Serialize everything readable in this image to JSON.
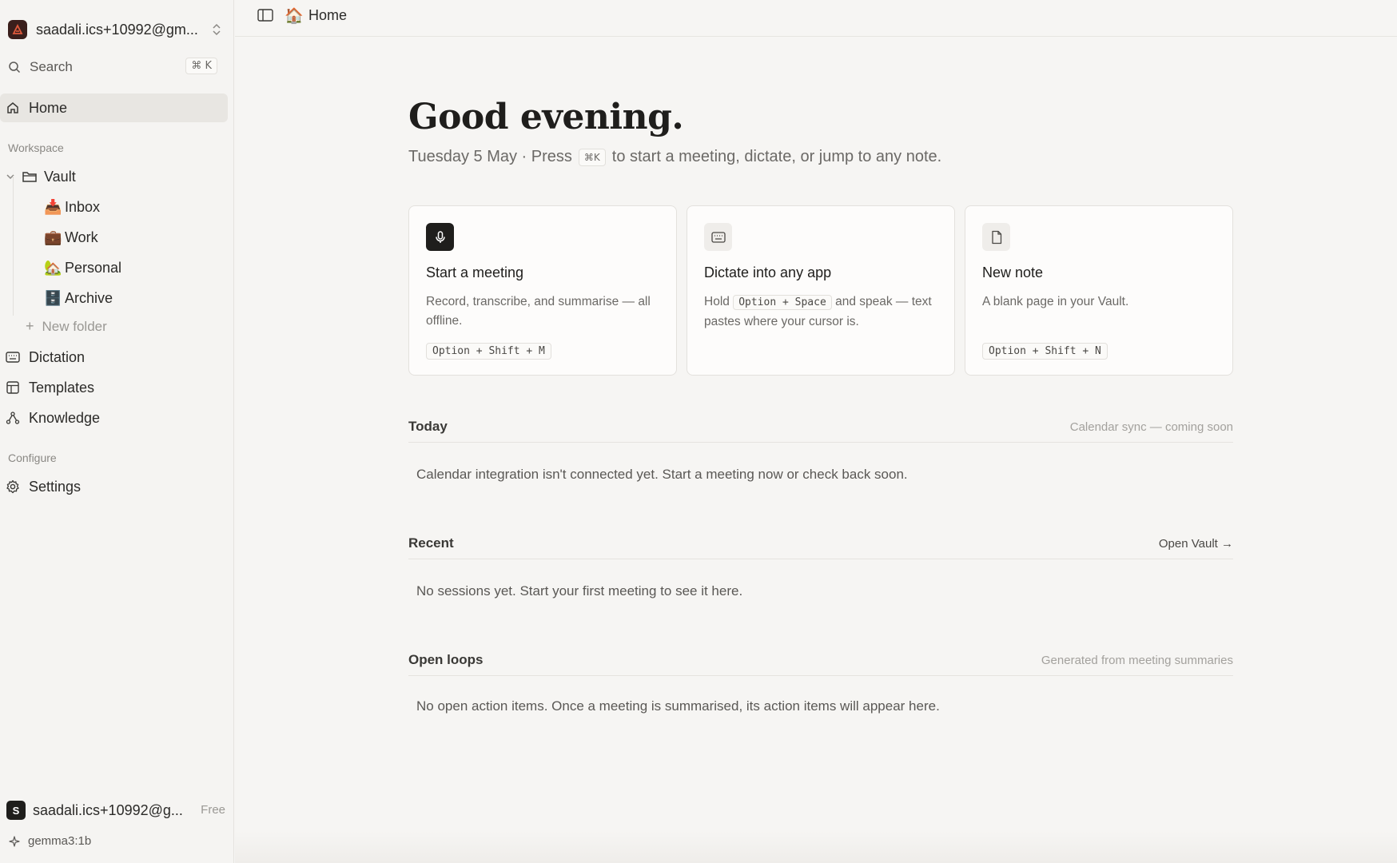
{
  "sidebar": {
    "account": {
      "name": "saadali.ics+10992@gm..."
    },
    "search": {
      "label": "Search",
      "shortcut": "⌘ K"
    },
    "home_label": "Home",
    "workspace_label": "Workspace",
    "vault_label": "Vault",
    "folders": [
      {
        "emoji": "📥",
        "label": "Inbox"
      },
      {
        "emoji": "💼",
        "label": "Work"
      },
      {
        "emoji": "🏡",
        "label": "Personal"
      },
      {
        "emoji": "🗄️",
        "label": "Archive"
      }
    ],
    "new_folder_label": "New folder",
    "dictation_label": "Dictation",
    "templates_label": "Templates",
    "knowledge_label": "Knowledge",
    "configure_label": "Configure",
    "settings_label": "Settings",
    "user": {
      "initial": "S",
      "name": "saadali.ics+10992@g...",
      "plan": "Free"
    },
    "model": "gemma3:1b"
  },
  "topbar": {
    "breadcrumb_emoji": "🏠",
    "breadcrumb": "Home"
  },
  "main": {
    "greeting": "Good evening.",
    "subline": {
      "date_text": "Tuesday 5 May · Press",
      "kbd": "⌘K",
      "rest": "to start a meeting, dictate, or jump to any note."
    },
    "cards": [
      {
        "icon": "microphone-icon",
        "title": "Start a meeting",
        "desc": "Record, transcribe, and summarise — all offline.",
        "shortcut": "Option + Shift + M"
      },
      {
        "icon": "keyboard-icon",
        "title": "Dictate into any app",
        "desc_pre": "Hold",
        "desc_kbd": "Option + Space",
        "desc_post": "and speak — text pastes where your cursor is."
      },
      {
        "icon": "document-icon",
        "title": "New note",
        "desc": "A blank page in your Vault.",
        "shortcut": "Option + Shift + N"
      }
    ],
    "today": {
      "title": "Today",
      "aside": "Calendar sync — coming soon",
      "message": "Calendar integration isn't connected yet. Start a meeting now or check back soon."
    },
    "recent": {
      "title": "Recent",
      "aside": "Open Vault →",
      "message": "No sessions yet. Start your first meeting to see it here."
    },
    "open_loops": {
      "title": "Open loops",
      "aside": "Generated from meeting summaries",
      "message": "No open action items. Once a meeting is summarised, its action items will appear here."
    }
  },
  "colors": {
    "brand_logo": "#3a1f1c",
    "accent_logo": "#e05a3c",
    "background": "#f6f5f3"
  }
}
